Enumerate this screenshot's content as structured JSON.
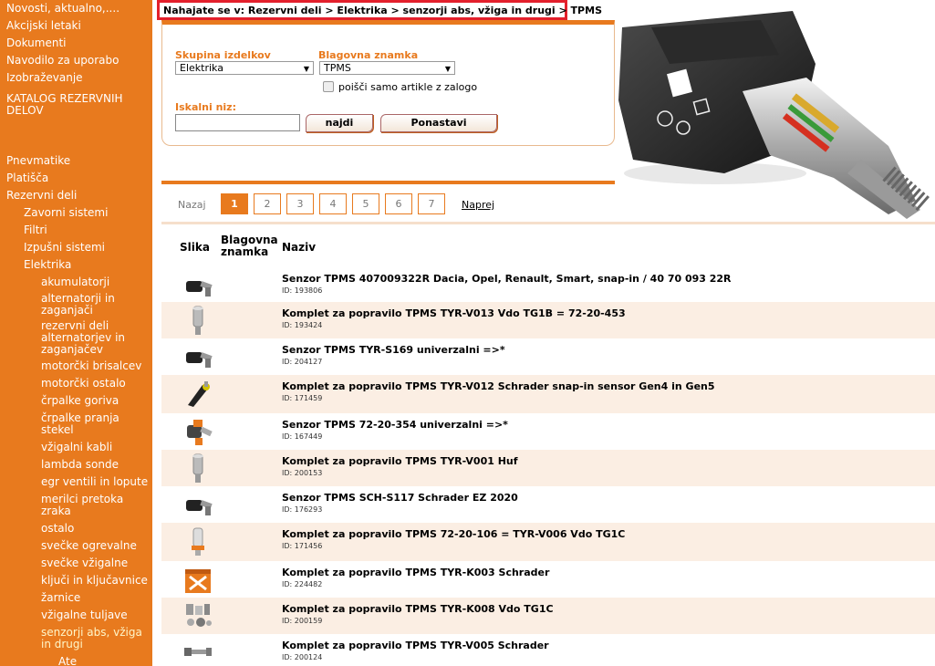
{
  "sidebar": {
    "top_links": [
      "Novosti, aktualno,....",
      "Akcijski letaki",
      "Dokumenti",
      "Navodilo za uporabo",
      "Izobraževanje",
      "KATALOG REZERVNIH DELOV"
    ],
    "categories": [
      {
        "label": "Pnevmatike",
        "level": 0
      },
      {
        "label": "Platišča",
        "level": 0
      },
      {
        "label": "Rezervni deli",
        "level": 0
      },
      {
        "label": "Zavorni sistemi",
        "level": 1
      },
      {
        "label": "Filtri",
        "level": 1
      },
      {
        "label": "Izpušni sistemi",
        "level": 1
      },
      {
        "label": "Elektrika",
        "level": 1
      },
      {
        "label": "akumulatorji",
        "level": 2
      },
      {
        "label": "alternatorji in zaganjači",
        "level": 2
      },
      {
        "label": "rezervni deli alternatorjev in zaganjačev",
        "level": 2
      },
      {
        "label": "motorčki brisalcev",
        "level": 2
      },
      {
        "label": "motorčki ostalo",
        "level": 2
      },
      {
        "label": "črpalke goriva",
        "level": 2
      },
      {
        "label": "črpalke pranja stekel",
        "level": 2
      },
      {
        "label": "vžigalni kabli",
        "level": 2
      },
      {
        "label": "lambda sonde",
        "level": 2
      },
      {
        "label": "egr ventili in lopute",
        "level": 2
      },
      {
        "label": "merilci pretoka zraka",
        "level": 2
      },
      {
        "label": "ostalo",
        "level": 2
      },
      {
        "label": "svečke ogrevalne",
        "level": 2
      },
      {
        "label": "svečke vžigalne",
        "level": 2
      },
      {
        "label": "ključi in ključavnice",
        "level": 2
      },
      {
        "label": "žarnice",
        "level": 2
      },
      {
        "label": "vžigalne tuljave",
        "level": 2
      },
      {
        "label": "senzorji abs, vžiga in drugi",
        "level": 2
      },
      {
        "label": "Ate",
        "level": 3
      }
    ]
  },
  "breadcrumb": "Nahajate se v: Rezervni deli > Elektrika > senzorji abs, vžiga in drugi > TPMS",
  "search": {
    "group_label": "Skupina izdelkov",
    "group_value": "Elektrika",
    "brand_label": "Blagovna znamka",
    "brand_value": "TPMS",
    "stock_only_label": "poišči samo artikle z zalogo",
    "query_label": "Iskalni niz:",
    "query_value": "",
    "search_button": "najdi",
    "reset_button": "Ponastavi"
  },
  "pager": {
    "prev": "Nazaj",
    "pages": [
      "1",
      "2",
      "3",
      "4",
      "5",
      "6",
      "7"
    ],
    "current": 0,
    "next": "Naprej"
  },
  "table": {
    "headers": {
      "image": "Slika",
      "brand": "Blagovna znamka",
      "name": "Naziv"
    },
    "rows": [
      {
        "name": "Senzor TPMS 407009322R Dacia, Opel, Renault, Smart, snap-in / 40 70 093 22R",
        "id": "ID: 193806",
        "thumb": "tpms-sensor-black"
      },
      {
        "name": "Komplet za popravilo TPMS TYR-V013 Vdo TG1B = 72-20-453",
        "id": "ID: 193424",
        "thumb": "valve-kit-silver"
      },
      {
        "name": "Senzor TPMS TYR-S169 univerzalni =>*",
        "id": "ID: 204127",
        "thumb": "tpms-sensor-black"
      },
      {
        "name": "Komplet za popravilo TPMS TYR-V012 Schrader snap-in sensor Gen4 in Gen5",
        "id": "ID: 171459",
        "thumb": "snap-in-valve"
      },
      {
        "name": "Senzor TPMS 72-20-354 univerzalni =>*",
        "id": "ID: 167449",
        "thumb": "tpms-sensor-orange"
      },
      {
        "name": "Komplet za popravilo TPMS TYR-V001 Huf",
        "id": "ID: 200153",
        "thumb": "valve-kit-silver"
      },
      {
        "name": "Senzor TPMS SCH-S117 Schrader EZ 2020",
        "id": "ID: 176293",
        "thumb": "tpms-sensor-black"
      },
      {
        "name": "Komplet za popravilo TPMS 72-20-106 = TYR-V006 Vdo TG1C",
        "id": "ID: 171456",
        "thumb": "valve-kit-orange"
      },
      {
        "name": "Komplet za popravilo TPMS TYR-K003 Schrader",
        "id": "ID: 224482",
        "thumb": "no-image-box"
      },
      {
        "name": "Komplet za popravilo TPMS TYR-K008 Vdo TG1C",
        "id": "ID: 200159",
        "thumb": "parts-set"
      },
      {
        "name": "Komplet za popravilo TPMS TYR-V005 Schrader",
        "id": "ID: 200124",
        "thumb": "valve-stem"
      }
    ]
  },
  "colors": {
    "accent": "#e87a1e",
    "breadcrumb_border": "#e3202c",
    "row_alt": "#fbeee3"
  }
}
